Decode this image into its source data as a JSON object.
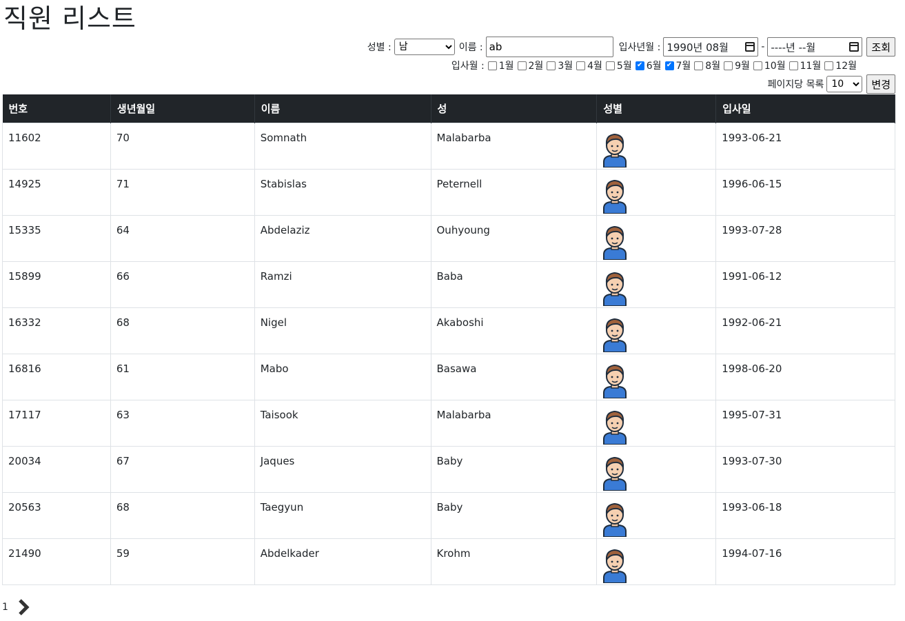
{
  "page": {
    "title": "직원 리스트"
  },
  "filters": {
    "gender_label": "성별 :",
    "gender_value": "남",
    "name_label": "이름 :",
    "name_value": "ab",
    "hire_ym_label": "입사년월 :",
    "hire_from": "1990년 08월",
    "range_sep": "-",
    "hire_to": "----년 --월",
    "search_button": "조회",
    "hire_month_label": "입사월 :",
    "months": [
      {
        "label": "1월",
        "checked": false
      },
      {
        "label": "2월",
        "checked": false
      },
      {
        "label": "3월",
        "checked": false
      },
      {
        "label": "4월",
        "checked": false
      },
      {
        "label": "5월",
        "checked": false
      },
      {
        "label": "6월",
        "checked": true
      },
      {
        "label": "7월",
        "checked": true
      },
      {
        "label": "8월",
        "checked": false
      },
      {
        "label": "9월",
        "checked": false
      },
      {
        "label": "10월",
        "checked": false
      },
      {
        "label": "11월",
        "checked": false
      },
      {
        "label": "12월",
        "checked": false
      }
    ],
    "per_page_label": "페이지당 목록",
    "per_page_value": "10",
    "change_button": "변경"
  },
  "table": {
    "headers": [
      "번호",
      "생년월일",
      "이름",
      "성",
      "성별",
      "입사일"
    ],
    "rows": [
      {
        "no": "11602",
        "birth": "70",
        "first": "Somnath",
        "last": "Malabarba",
        "hire": "1993-06-21"
      },
      {
        "no": "14925",
        "birth": "71",
        "first": "Stabislas",
        "last": "Peternell",
        "hire": "1996-06-15"
      },
      {
        "no": "15335",
        "birth": "64",
        "first": "Abdelaziz",
        "last": "Ouhyoung",
        "hire": "1993-07-28"
      },
      {
        "no": "15899",
        "birth": "66",
        "first": "Ramzi",
        "last": "Baba",
        "hire": "1991-06-12"
      },
      {
        "no": "16332",
        "birth": "68",
        "first": "Nigel",
        "last": "Akaboshi",
        "hire": "1992-06-21"
      },
      {
        "no": "16816",
        "birth": "61",
        "first": "Mabo",
        "last": "Basawa",
        "hire": "1998-06-20"
      },
      {
        "no": "17117",
        "birth": "63",
        "first": "Taisook",
        "last": "Malabarba",
        "hire": "1995-07-31"
      },
      {
        "no": "20034",
        "birth": "67",
        "first": "Jaques",
        "last": "Baby",
        "hire": "1993-07-30"
      },
      {
        "no": "20563",
        "birth": "68",
        "first": "Taegyun",
        "last": "Baby",
        "hire": "1993-06-18"
      },
      {
        "no": "21490",
        "birth": "59",
        "first": "Abdelkader",
        "last": "Krohm",
        "hire": "1994-07-16"
      }
    ],
    "gender_icon": "male-avatar-icon"
  },
  "pagination": {
    "current": "1",
    "next_icon": "chevron-right-icon"
  }
}
